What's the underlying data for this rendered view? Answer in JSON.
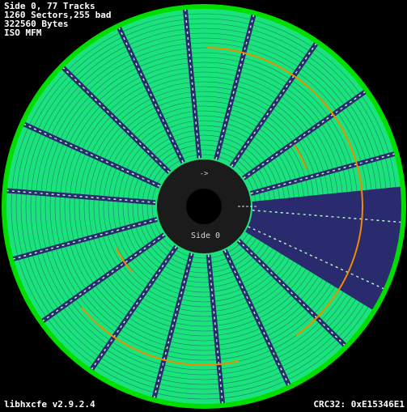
{
  "header": {
    "side_tracks": "Side 0, 77 Tracks",
    "sectors": "1260 Sectors,255 bad",
    "bytes": "322560 Bytes",
    "encoding": "ISO MFM"
  },
  "disk": {
    "side_label": "Side 0",
    "direction_arrow": "->",
    "colors": {
      "good_sector": "#19e37a",
      "bad_sector": "#2a2a6e",
      "outer_ring": "#00dd00",
      "hub": "#1a1a1a",
      "highlight": "#f08a00",
      "light_mark": "#b8f8c8"
    }
  },
  "footer": {
    "version": "libhxcfe v2.9.2.4",
    "crc": "CRC32: 0xE15346E1"
  }
}
